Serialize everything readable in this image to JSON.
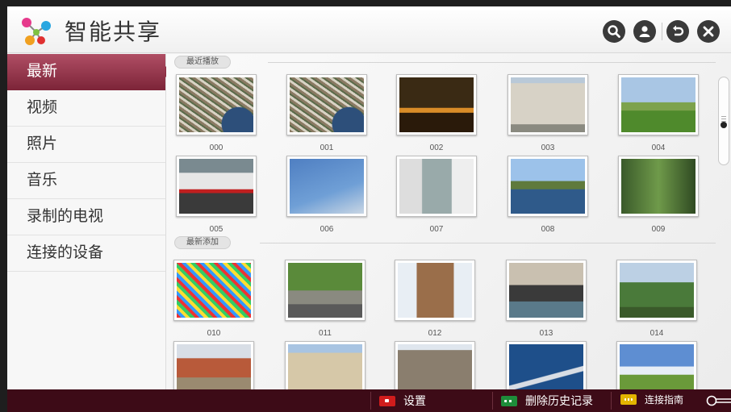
{
  "header": {
    "title": "智能共享",
    "icons": [
      "search-icon",
      "user-icon",
      "back-icon",
      "close-icon"
    ]
  },
  "sidebar": {
    "items": [
      {
        "label": "最新",
        "active": true
      },
      {
        "label": "视频",
        "active": false
      },
      {
        "label": "照片",
        "active": false
      },
      {
        "label": "音乐",
        "active": false
      },
      {
        "label": "录制的电视",
        "active": false
      },
      {
        "label": "连接的设备",
        "active": false
      }
    ]
  },
  "sections": {
    "recent_label": "最近播放",
    "added_label": "最新添加"
  },
  "recent_items": [
    {
      "label": "000",
      "scene": "coast"
    },
    {
      "label": "001",
      "scene": "coast"
    },
    {
      "label": "002",
      "scene": "night-city"
    },
    {
      "label": "003",
      "scene": "building"
    },
    {
      "label": "004",
      "scene": "field"
    },
    {
      "label": "005",
      "scene": "train"
    },
    {
      "label": "006",
      "scene": "sky"
    },
    {
      "label": "007",
      "scene": "alley"
    },
    {
      "label": "008",
      "scene": "river"
    },
    {
      "label": "009",
      "scene": "forest-rail"
    }
  ],
  "added_items": [
    {
      "label": "010",
      "scene": "graffiti"
    },
    {
      "label": "011",
      "scene": "street"
    },
    {
      "label": "012",
      "scene": "cathedral"
    },
    {
      "label": "013",
      "scene": "gondola"
    },
    {
      "label": "014",
      "scene": "mountain"
    },
    {
      "label": "",
      "scene": "houses"
    },
    {
      "label": "",
      "scene": "arch"
    },
    {
      "label": "",
      "scene": "notre-dame"
    },
    {
      "label": "",
      "scene": "wing"
    },
    {
      "label": "",
      "scene": "clouds-field"
    }
  ],
  "footer": {
    "settings": "设置",
    "delete_history": "删除历史记录",
    "guide": "连接指南"
  },
  "colors": {
    "accent": "#8a2c41",
    "footer_bg": "#3d0b17",
    "header_icon": "#3a3a3a"
  }
}
